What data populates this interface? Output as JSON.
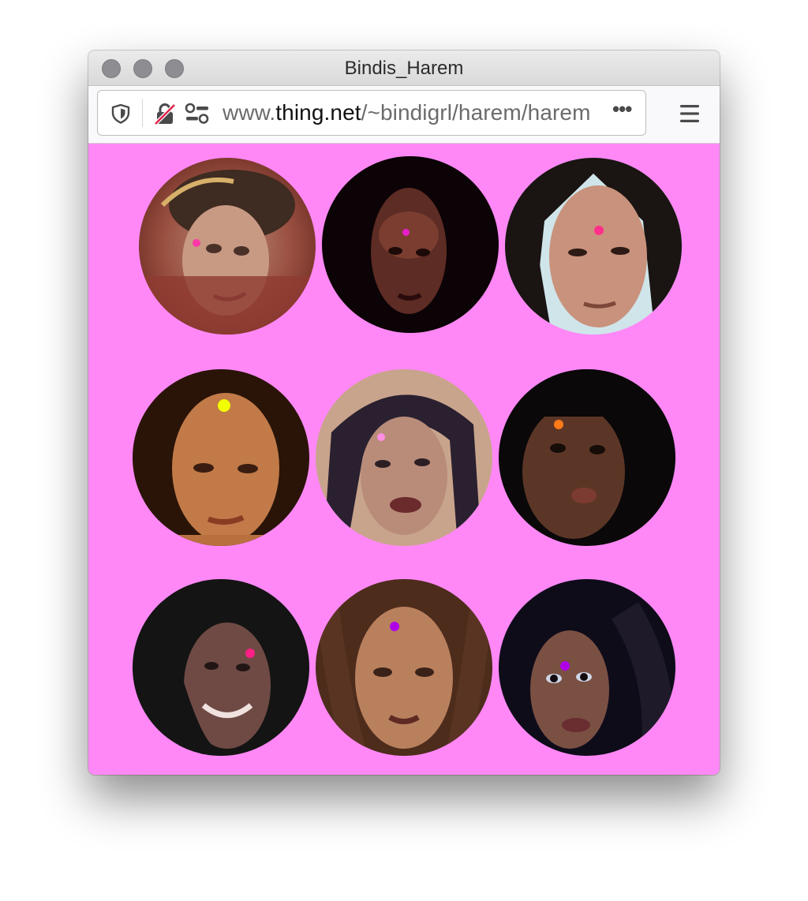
{
  "window": {
    "title": "Bindis_Harem"
  },
  "urlbar": {
    "url_prefix": "www.",
    "url_host": "thing.net",
    "url_path": "/~bindigrl/harem/harem",
    "page_actions_label": "•••"
  },
  "content": {
    "background": "#ff88f6",
    "portraits": [
      {
        "bindi_color": "#ff3aa8"
      },
      {
        "bindi_color": "#e61ec8"
      },
      {
        "bindi_color": "#ff2f8a"
      },
      {
        "bindi_color": "#f2ff00"
      },
      {
        "bindi_color": "#ff8fe3"
      },
      {
        "bindi_color": "#ff7a18"
      },
      {
        "bindi_color": "#ff1f85"
      },
      {
        "bindi_color": "#b000e8"
      },
      {
        "bindi_color": "#b000e8"
      }
    ]
  }
}
